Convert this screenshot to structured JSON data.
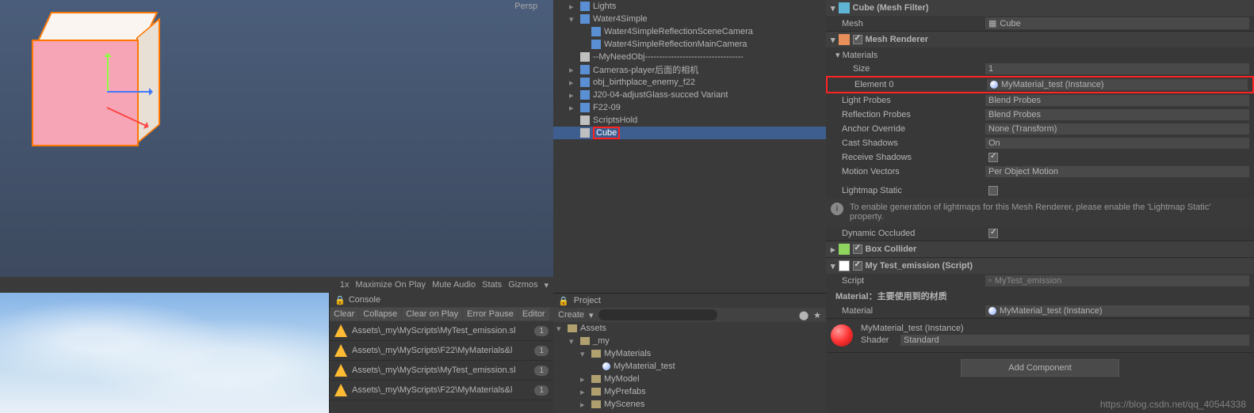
{
  "scene": {
    "persp_label": "Persp"
  },
  "game_toolbar": {
    "scale": "1x",
    "maximize": "Maximize On Play",
    "mute": "Mute Audio",
    "stats": "Stats",
    "gizmos": "Gizmos"
  },
  "console": {
    "tab": "Console",
    "buttons": {
      "clear": "Clear",
      "collapse": "Collapse",
      "clear_play": "Clear on Play",
      "error_pause": "Error Pause",
      "editor": "Editor"
    },
    "items": [
      {
        "text": "Assets\\_my\\MyScripts\\MyTest_emission.sl",
        "count": "1"
      },
      {
        "text": "Assets\\_my\\MyScripts\\F22\\MyMaterials&l",
        "count": "1"
      },
      {
        "text": "Assets\\_my\\MyScripts\\MyTest_emission.sl",
        "count": "1"
      },
      {
        "text": "Assets\\_my\\MyScripts\\F22\\MyMaterials&l",
        "count": "1"
      }
    ]
  },
  "hierarchy": {
    "items": [
      {
        "indent": 1,
        "icon": "prefab",
        "label": "Lights",
        "fold": "▸"
      },
      {
        "indent": 1,
        "icon": "prefab",
        "label": "Water4Simple",
        "fold": "▾"
      },
      {
        "indent": 2,
        "icon": "prefab",
        "label": "Water4SimpleReflectionSceneCamera"
      },
      {
        "indent": 2,
        "icon": "prefab",
        "label": "Water4SimpleReflectionMainCamera"
      },
      {
        "indent": 1,
        "icon": "go",
        "label": "--MyNeedObj----------------------------------"
      },
      {
        "indent": 1,
        "icon": "prefab",
        "label": "Cameras-player后面的相机",
        "fold": "▸"
      },
      {
        "indent": 1,
        "icon": "prefab",
        "label": "obj_birthplace_enemy_f22",
        "fold": "▸"
      },
      {
        "indent": 1,
        "icon": "prefab",
        "label": "J20-04-adjustGlass-succed Variant",
        "fold": "▸"
      },
      {
        "indent": 1,
        "icon": "prefab",
        "label": "F22-09",
        "fold": "▸"
      },
      {
        "indent": 1,
        "icon": "go",
        "label": "ScriptsHold"
      },
      {
        "indent": 1,
        "icon": "go",
        "label": "Cube",
        "selected": true,
        "highlight": true
      }
    ]
  },
  "project": {
    "tab": "Project",
    "create": "Create",
    "root": "Assets",
    "items": [
      {
        "indent": 1,
        "label": "_my",
        "fold": "▾"
      },
      {
        "indent": 2,
        "label": "MyMaterials",
        "fold": "▾"
      },
      {
        "indent": 3,
        "label": "MyMaterial_test",
        "type": "mat"
      },
      {
        "indent": 2,
        "label": "MyModel",
        "fold": "▸"
      },
      {
        "indent": 2,
        "label": "MyPrefabs",
        "fold": "▸"
      },
      {
        "indent": 2,
        "label": "MyScenes",
        "fold": "▸"
      }
    ]
  },
  "inspector": {
    "mesh_filter": {
      "title": "Cube (Mesh Filter)",
      "mesh_label": "Mesh",
      "mesh_value": "Cube"
    },
    "mesh_renderer": {
      "title": "Mesh Renderer",
      "materials": "Materials",
      "size_label": "Size",
      "size_value": "1",
      "element0_label": "Element 0",
      "element0_value": "MyMaterial_test (Instance)",
      "light_probes_label": "Light Probes",
      "light_probes_value": "Blend Probes",
      "reflection_probes_label": "Reflection Probes",
      "reflection_probes_value": "Blend Probes",
      "anchor_label": "Anchor Override",
      "anchor_value": "None (Transform)",
      "cast_shadows_label": "Cast Shadows",
      "cast_shadows_value": "On",
      "receive_shadows_label": "Receive Shadows",
      "motion_vectors_label": "Motion Vectors",
      "motion_vectors_value": "Per Object Motion",
      "lightmap_static_label": "Lightmap Static",
      "info": "To enable generation of lightmaps for this Mesh Renderer, please enable the 'Lightmap Static'",
      "info2": "property.",
      "dynamic_occluded_label": "Dynamic Occluded"
    },
    "box_collider": {
      "title": "Box Collider"
    },
    "script": {
      "title": "My Test_emission (Script)",
      "script_label": "Script",
      "script_value": "MyTest_emission",
      "material_header": "Material：主要使用到的材质",
      "material_label": "Material",
      "material_value": "MyMaterial_test (Instance)"
    },
    "material": {
      "name": "MyMaterial_test (Instance)",
      "shader_label": "Shader",
      "shader_value": "Standard"
    },
    "add_component": "Add Component"
  },
  "watermark": "https://blog.csdn.net/qq_40544338"
}
